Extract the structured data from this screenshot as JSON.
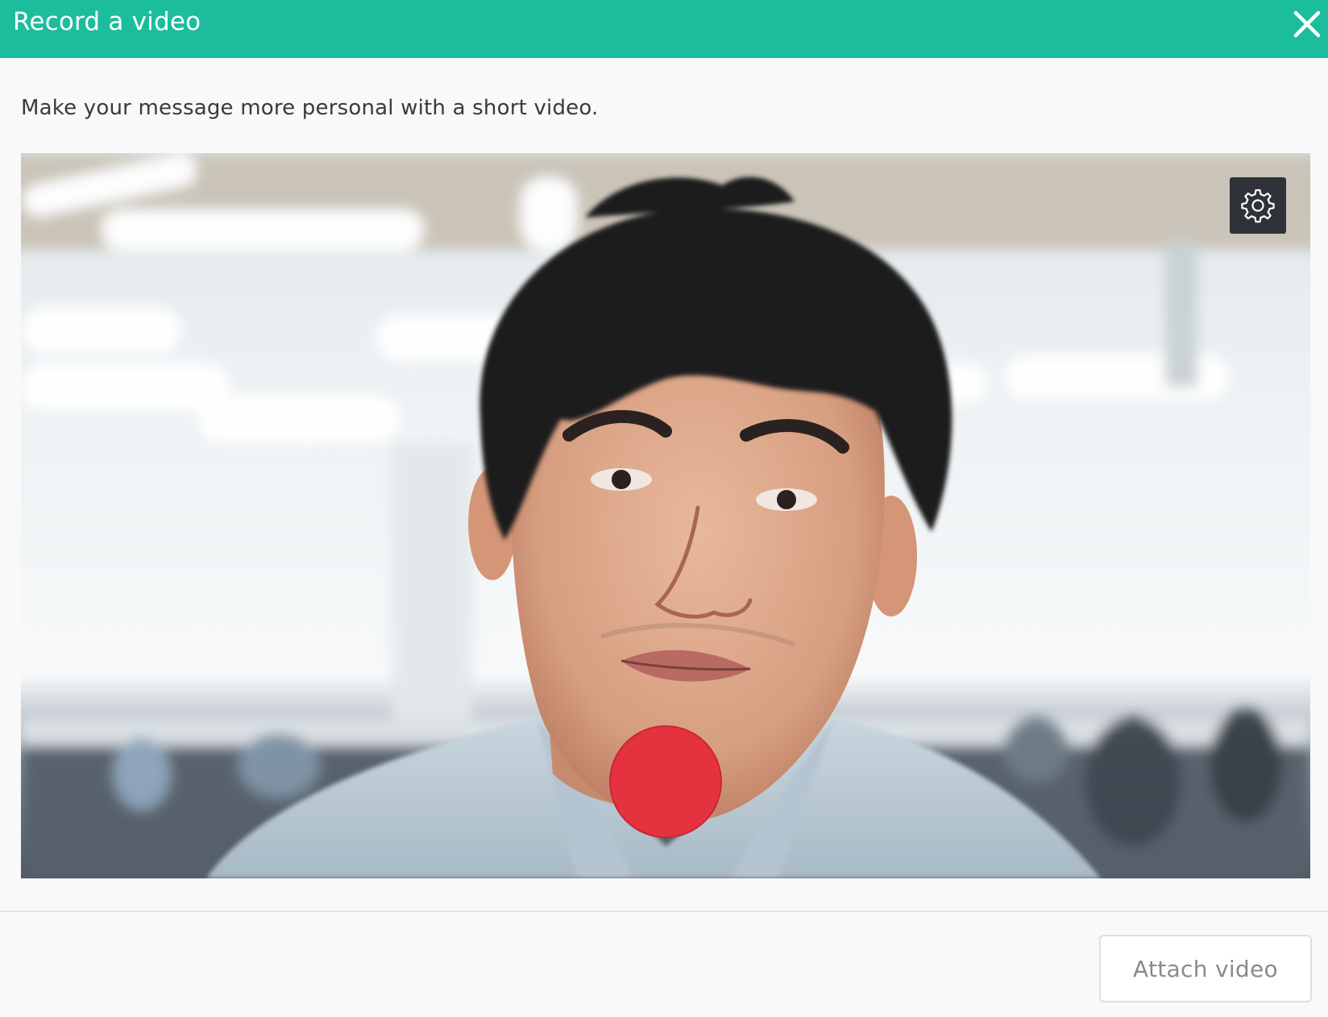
{
  "modal": {
    "title": "Record a video",
    "close_icon": "close-icon"
  },
  "body": {
    "description": "Make your message more personal with a short video."
  },
  "video": {
    "settings_icon": "gear-icon",
    "record_icon": "record-button",
    "record_color": "#e5323f"
  },
  "footer": {
    "attach_label": "Attach video",
    "attach_disabled": true
  },
  "colors": {
    "header": "#1cbd9d",
    "background": "#f9f9f9",
    "settings_bg": "#2f3337"
  }
}
